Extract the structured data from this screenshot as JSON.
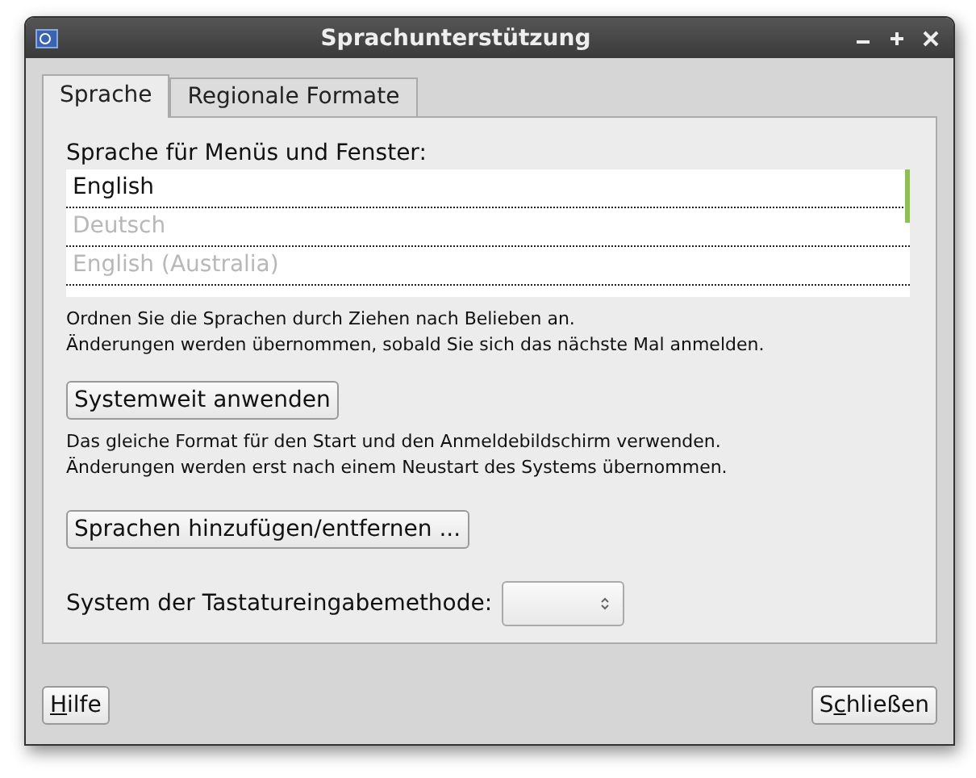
{
  "window": {
    "title": "Sprachunterstützung"
  },
  "tabs": [
    {
      "label": "Sprache",
      "selected": true
    },
    {
      "label": "Regionale Formate",
      "selected": false
    }
  ],
  "languages": {
    "label": "Sprache für Menüs und Fenster:",
    "items": [
      {
        "name": "English",
        "dimmed": false
      },
      {
        "name": "Deutsch",
        "dimmed": true
      },
      {
        "name": "English (Australia)",
        "dimmed": true
      }
    ]
  },
  "hint_order": [
    "Ordnen Sie die Sprachen durch Ziehen nach Belieben an.",
    "Änderungen werden übernommen, sobald Sie sich das nächste Mal anmelden."
  ],
  "apply_button": "Systemweit anwenden",
  "hint_apply": [
    "Das gleiche Format für den Start und den Anmeldebildschirm verwenden.",
    "Änderungen werden erst nach einem Neustart des Systems übernommen."
  ],
  "install_button": "Sprachen hinzufügen/entfernen ...",
  "input_method": {
    "label": "System der Tastatureingabemethode:"
  },
  "buttons": [
    {
      "mnemonic": "H",
      "after": "ilfe"
    },
    {
      "before": "S",
      "mnemonic": "c",
      "after": "hließen"
    }
  ]
}
